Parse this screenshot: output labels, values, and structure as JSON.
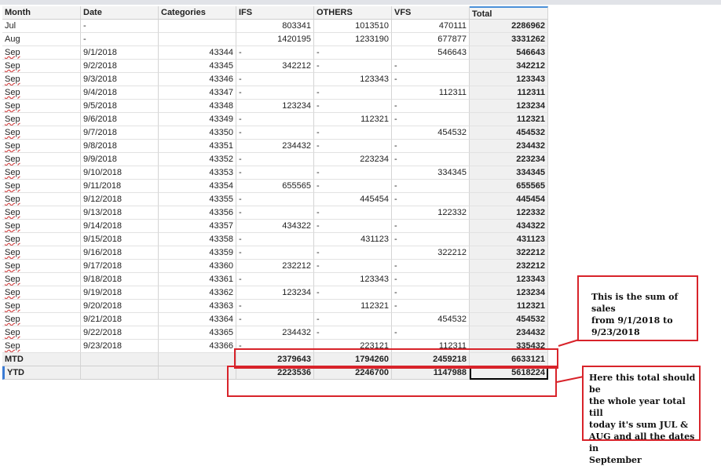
{
  "headers": [
    "Month",
    "Date",
    "Categories",
    "IFS",
    "OTHERS",
    "VFS",
    "Total"
  ],
  "rows": [
    {
      "month": "Jul",
      "date": "-",
      "cat": "",
      "ifs": "803341",
      "oth": "1013510",
      "vfs": "470111",
      "total": "2286962"
    },
    {
      "month": "Aug",
      "date": "-",
      "cat": "",
      "ifs": "1420195",
      "oth": "1233190",
      "vfs": "677877",
      "total": "3331262"
    },
    {
      "month": "Sep",
      "date": "9/1/2018",
      "cat": "43344",
      "ifs": "-",
      "oth": "-",
      "vfs": "546643",
      "total": "546643"
    },
    {
      "month": "Sep",
      "date": "9/2/2018",
      "cat": "43345",
      "ifs": "342212",
      "oth": "-",
      "vfs": "-",
      "total": "342212"
    },
    {
      "month": "Sep",
      "date": "9/3/2018",
      "cat": "43346",
      "ifs": "-",
      "oth": "123343",
      "vfs": "-",
      "total": "123343"
    },
    {
      "month": "Sep",
      "date": "9/4/2018",
      "cat": "43347",
      "ifs": "-",
      "oth": "-",
      "vfs": "112311",
      "total": "112311"
    },
    {
      "month": "Sep",
      "date": "9/5/2018",
      "cat": "43348",
      "ifs": "123234",
      "oth": "-",
      "vfs": "-",
      "total": "123234"
    },
    {
      "month": "Sep",
      "date": "9/6/2018",
      "cat": "43349",
      "ifs": "-",
      "oth": "112321",
      "vfs": "-",
      "total": "112321"
    },
    {
      "month": "Sep",
      "date": "9/7/2018",
      "cat": "43350",
      "ifs": "-",
      "oth": "-",
      "vfs": "454532",
      "total": "454532"
    },
    {
      "month": "Sep",
      "date": "9/8/2018",
      "cat": "43351",
      "ifs": "234432",
      "oth": "-",
      "vfs": "-",
      "total": "234432"
    },
    {
      "month": "Sep",
      "date": "9/9/2018",
      "cat": "43352",
      "ifs": "-",
      "oth": "223234",
      "vfs": "-",
      "total": "223234"
    },
    {
      "month": "Sep",
      "date": "9/10/2018",
      "cat": "43353",
      "ifs": "-",
      "oth": "-",
      "vfs": "334345",
      "total": "334345"
    },
    {
      "month": "Sep",
      "date": "9/11/2018",
      "cat": "43354",
      "ifs": "655565",
      "oth": "-",
      "vfs": "-",
      "total": "655565"
    },
    {
      "month": "Sep",
      "date": "9/12/2018",
      "cat": "43355",
      "ifs": "-",
      "oth": "445454",
      "vfs": "-",
      "total": "445454"
    },
    {
      "month": "Sep",
      "date": "9/13/2018",
      "cat": "43356",
      "ifs": "-",
      "oth": "-",
      "vfs": "122332",
      "total": "122332"
    },
    {
      "month": "Sep",
      "date": "9/14/2018",
      "cat": "43357",
      "ifs": "434322",
      "oth": "-",
      "vfs": "-",
      "total": "434322"
    },
    {
      "month": "Sep",
      "date": "9/15/2018",
      "cat": "43358",
      "ifs": "-",
      "oth": "431123",
      "vfs": "-",
      "total": "431123"
    },
    {
      "month": "Sep",
      "date": "9/16/2018",
      "cat": "43359",
      "ifs": "-",
      "oth": "-",
      "vfs": "322212",
      "total": "322212"
    },
    {
      "month": "Sep",
      "date": "9/17/2018",
      "cat": "43360",
      "ifs": "232212",
      "oth": "-",
      "vfs": "-",
      "total": "232212"
    },
    {
      "month": "Sep",
      "date": "9/18/2018",
      "cat": "43361",
      "ifs": "-",
      "oth": "123343",
      "vfs": "-",
      "total": "123343"
    },
    {
      "month": "Sep",
      "date": "9/19/2018",
      "cat": "43362",
      "ifs": "123234",
      "oth": "-",
      "vfs": "-",
      "total": "123234"
    },
    {
      "month": "Sep",
      "date": "9/20/2018",
      "cat": "43363",
      "ifs": "-",
      "oth": "112321",
      "vfs": "-",
      "total": "112321"
    },
    {
      "month": "Sep",
      "date": "9/21/2018",
      "cat": "43364",
      "ifs": "-",
      "oth": "-",
      "vfs": "454532",
      "total": "454532"
    },
    {
      "month": "Sep",
      "date": "9/22/2018",
      "cat": "43365",
      "ifs": "234432",
      "oth": "-",
      "vfs": "-",
      "total": "234432"
    },
    {
      "month": "Sep",
      "date": "9/23/2018",
      "cat": "43366",
      "ifs": "-",
      "oth": "223121",
      "vfs": "112311",
      "total": "335432"
    }
  ],
  "mtd": {
    "label": "MTD",
    "ifs": "2379643",
    "oth": "1794260",
    "vfs": "2459218",
    "total": "6633121"
  },
  "ytd": {
    "label": "YTD",
    "ifs": "2223536",
    "oth": "2246700",
    "vfs": "1147988",
    "total": "5618224"
  },
  "annotations": {
    "mtd_note": [
      "This is the sum of sales",
      "from 9/1/2018 to",
      "9/23/2018"
    ],
    "ytd_note": [
      "Here this total should be",
      "the whole year total till",
      "today it's sum JUL &",
      "AUG and all the dates in",
      "September"
    ]
  },
  "colors": {
    "annotation_red": "#d8232a",
    "selection_blue": "#3a7bd5"
  }
}
